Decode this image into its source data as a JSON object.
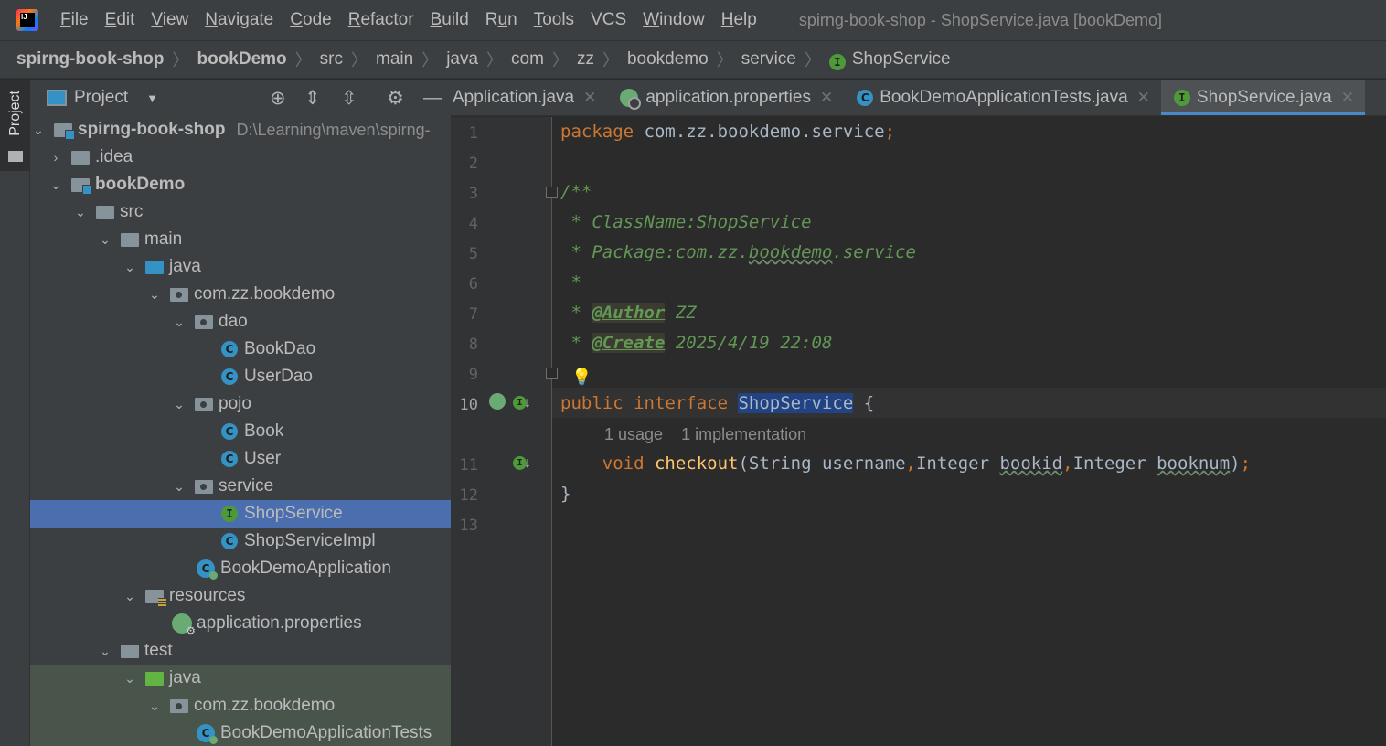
{
  "menubar": {
    "logo_text": "IJ",
    "items": [
      {
        "mnemonic": "F",
        "rest": "ile"
      },
      {
        "mnemonic": "E",
        "rest": "dit"
      },
      {
        "mnemonic": "V",
        "rest": "iew"
      },
      {
        "mnemonic": "N",
        "rest": "avigate"
      },
      {
        "mnemonic": "C",
        "rest": "ode"
      },
      {
        "mnemonic": "R",
        "rest": "efactor"
      },
      {
        "mnemonic": "B",
        "rest": "uild"
      },
      {
        "mnemonic": "R",
        "rest": "un",
        "split": "R|u|n"
      },
      {
        "mnemonic": "T",
        "rest": "ools"
      },
      {
        "mnemonic": "VCS",
        "rest": ""
      },
      {
        "mnemonic": "W",
        "rest": "indow"
      },
      {
        "mnemonic": "H",
        "rest": "elp"
      }
    ],
    "window_title": "spirng-book-shop - ShopService.java [bookDemo]"
  },
  "breadcrumb": [
    "spirng-book-shop",
    "bookDemo",
    "src",
    "main",
    "java",
    "com",
    "zz",
    "bookdemo",
    "service",
    "ShopService"
  ],
  "tool_strip": {
    "project_tab": "Project"
  },
  "project_panel": {
    "title": "Project",
    "tree": [
      {
        "label": "spirng-book-shop",
        "path": "D:\\Learning\\maven\\spirng-",
        "bold": true
      },
      {
        "label": ".idea"
      },
      {
        "label": "bookDemo",
        "bold": true
      },
      {
        "label": "src"
      },
      {
        "label": "main"
      },
      {
        "label": "java"
      },
      {
        "label": "com.zz.bookdemo"
      },
      {
        "label": "dao"
      },
      {
        "label": "BookDao"
      },
      {
        "label": "UserDao"
      },
      {
        "label": "pojo"
      },
      {
        "label": "Book"
      },
      {
        "label": "User"
      },
      {
        "label": "service"
      },
      {
        "label": "ShopService"
      },
      {
        "label": "ShopServiceImpl"
      },
      {
        "label": "BookDemoApplication"
      },
      {
        "label": "resources"
      },
      {
        "label": "application.properties"
      },
      {
        "label": "test"
      },
      {
        "label": "java"
      },
      {
        "label": "com.zz.bookdemo"
      },
      {
        "label": "BookDemoApplicationTests"
      }
    ]
  },
  "editor_tabs": [
    {
      "label": "Application.java"
    },
    {
      "label": "application.properties"
    },
    {
      "label": "BookDemoApplicationTests.java"
    },
    {
      "label": "ShopService.java",
      "active": true
    }
  ],
  "editor": {
    "line_numbers": [
      "1",
      "2",
      "3",
      "4",
      "5",
      "6",
      "7",
      "8",
      "9",
      "10",
      "11",
      "12",
      "13"
    ],
    "line1": {
      "kw": "package",
      "pkg": " com.zz.bookdemo.service",
      "semi": ";"
    },
    "line3": "/**",
    "line4": " * ClassName:ShopService",
    "line5": {
      "a": " * Package:com.zz.",
      "b": "bookdemo",
      "c": ".service"
    },
    "line6": " *",
    "line7": {
      "star": " * ",
      "tag": "@Author",
      "val": " ZZ"
    },
    "line8": {
      "star": " * ",
      "tag": "@Create",
      "val": " 2025/4/19 22:08"
    },
    "line9": " */",
    "line10": {
      "kw1": "public",
      "kw2": " interface ",
      "name": "ShopService",
      "brace": " {"
    },
    "inlay": {
      "usages": "1 usage",
      "impls": "1 implementation"
    },
    "line11": {
      "indent": "    ",
      "kw": "void",
      "fn": " checkout",
      "p1": "(String username",
      "c1": ",",
      "p2": "Integer ",
      "a2": "bookid",
      "c2": ",",
      "p3": "Integer ",
      "a3": "booknum",
      "end": ")",
      "semi": ";"
    },
    "line12": "}"
  }
}
